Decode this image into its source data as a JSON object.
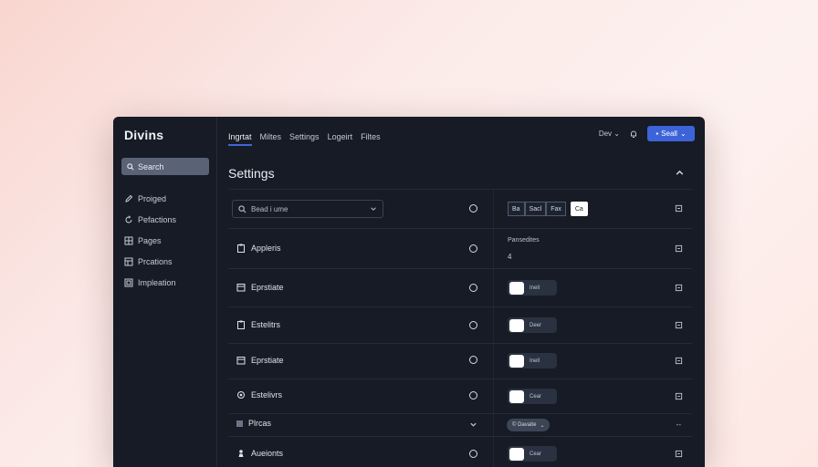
{
  "app": {
    "brand": "Divins"
  },
  "sidebar": {
    "search_label": "Search",
    "items": [
      {
        "label": "Proiged",
        "icon": "pencil-icon"
      },
      {
        "label": "Pefactions",
        "icon": "refresh-icon"
      },
      {
        "label": "Pages",
        "icon": "grid-icon"
      },
      {
        "label": "Prcations",
        "icon": "layers-icon"
      },
      {
        "label": "Impleation",
        "icon": "integration-icon"
      }
    ]
  },
  "topnav": {
    "tabs": [
      "Ingrtat",
      "Miltes",
      "Settings",
      "Logeirt",
      "Filtes"
    ],
    "active_index": 0,
    "lang_label": "Dev",
    "primary_button_label": "Seall"
  },
  "page": {
    "title": "Settings"
  },
  "rows": {
    "search": {
      "placeholder": "Bead i ume",
      "segment_buttons": [
        "Ba",
        "Sacl",
        "Fax"
      ],
      "selected_segment": "Ca"
    },
    "items": [
      {
        "label": "Appleris",
        "icon": "clipboard-icon",
        "right_type": "text",
        "sublabel": "Pansedites",
        "subvalue": "4"
      },
      {
        "label": "Eprstiate",
        "icon": "calendar-icon",
        "right_type": "toggle",
        "toggle_text": "Inell"
      },
      {
        "label": "Estelitrs",
        "icon": "clipboard-icon",
        "right_type": "toggle",
        "toggle_text": "Deer"
      },
      {
        "label": "Eprstiate",
        "icon": "calendar-icon",
        "right_type": "toggle",
        "toggle_text": "Inell"
      },
      {
        "label": "Estelivrs",
        "icon": "gear-icon",
        "right_type": "toggle",
        "toggle_text": "Cear"
      }
    ],
    "collapsed": {
      "label": "Plrcas",
      "pill_label": "© Davaite",
      "dash": "--"
    },
    "last": {
      "label": "Aueionts",
      "icon": "person-icon",
      "toggle_text": "Cear"
    }
  },
  "colors": {
    "accent": "#3d63d9",
    "window_bg": "#161b25",
    "sidebar_search_bg": "#5a6275"
  }
}
